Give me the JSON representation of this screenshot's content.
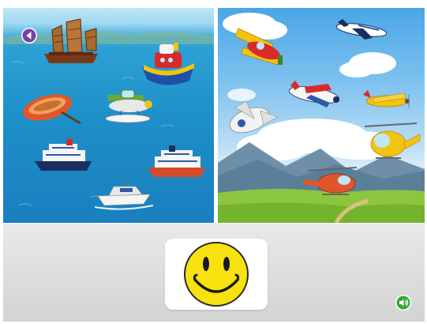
{
  "game": {
    "panels": [
      {
        "name": "sea",
        "theme": "water-vehicles"
      },
      {
        "name": "sky",
        "theme": "air-vehicles"
      }
    ],
    "sea_items": [
      "junk-ship",
      "tugboat",
      "rowboat",
      "seaplane",
      "cruise-ship-left",
      "cruise-ship-right",
      "speedboat"
    ],
    "sky_items": [
      "biplane-yellow",
      "jet-plane",
      "red-white-plane",
      "yellow-propeller-plane",
      "white-plane",
      "helicopter-yellow",
      "helicopter-red"
    ],
    "feedback": "smiley-face",
    "colors": {
      "accent_purple": "#7a3fb0",
      "sound_green": "#37a63a",
      "smiley_yellow": "#f7e210"
    }
  },
  "controls": {
    "back_icon": "back-arrow-icon",
    "sound_icon": "speaker-icon"
  }
}
